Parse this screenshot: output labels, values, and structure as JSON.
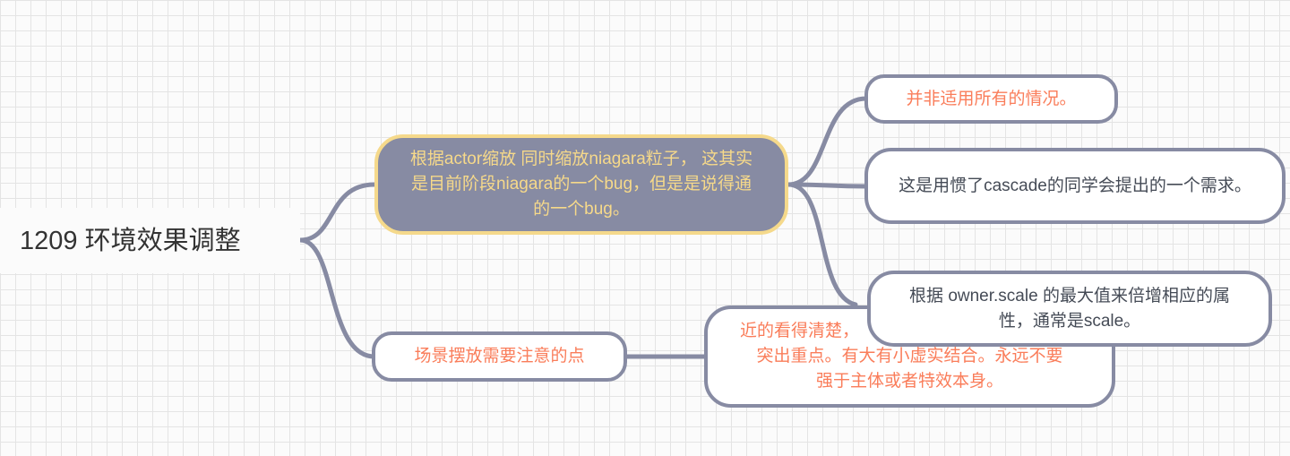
{
  "root": {
    "title": "1209 环境效果调整"
  },
  "branch_a": {
    "text": "根据actor缩放 同时缩放niagara粒子， 这其实是目前阶段niagara的一个bug，但是是说得通的一个bug。",
    "children": [
      "并非适用所有的情况。",
      "这是用惯了cascade的同学会提出的一个需求。",
      "根据 owner.scale 的最大值来倍增相应的属性，通常是scale。"
    ]
  },
  "branch_b": {
    "text": "场景摆放需要注意的点",
    "child": {
      "line1": "近的看得清楚，",
      "line2": "突出重点。有大有小虚实结合。永远不要",
      "line3": "强于主体或者特效本身。"
    }
  },
  "colors": {
    "line": "#878ba3",
    "highlight_fill": "#878ba3",
    "highlight_border": "#f5d98b",
    "orange": "#fa7d5a"
  }
}
